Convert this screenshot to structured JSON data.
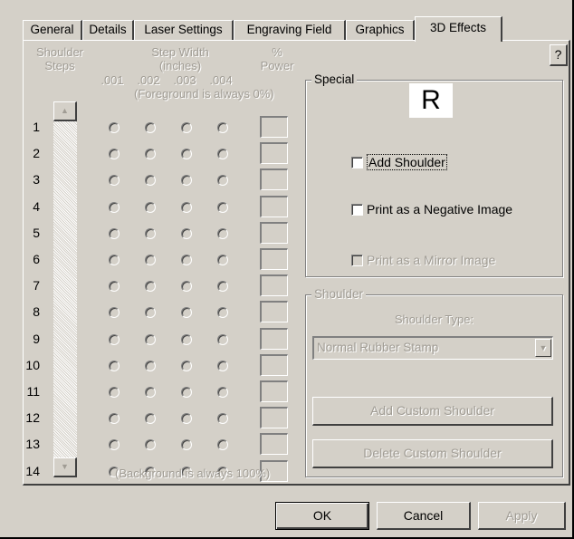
{
  "tabs": [
    "General",
    "Details",
    "Laser Settings",
    "Engraving Field",
    "Graphics",
    "3D Effects"
  ],
  "active_tab": "3D Effects",
  "help_label": "?",
  "shoulder_steps": {
    "header_line1": "Shoulder",
    "header_line2": "Steps",
    "rows": [
      "1",
      "2",
      "3",
      "4",
      "5",
      "6",
      "7",
      "8",
      "9",
      "10",
      "11",
      "12",
      "13",
      "14"
    ]
  },
  "step_width": {
    "header_line1": "Step Width",
    "header_line2": "(inches)",
    "columns": [
      ".001",
      ".002",
      ".003",
      ".004"
    ]
  },
  "power": {
    "header_line1": "%",
    "header_line2": "Power"
  },
  "foreground_note": "(Foreground is always 0%)",
  "background_note": "(Background is always 100%)",
  "special": {
    "legend": "Special",
    "preview_letter": "R",
    "add_shoulder": "Add Shoulder",
    "print_negative": "Print as a Negative Image",
    "print_mirror": "Print as a Mirror Image"
  },
  "shoulder_group": {
    "legend": "Shoulder",
    "type_label": "Shoulder Type:",
    "type_value": "Normal Rubber Stamp",
    "add_custom": "Add Custom Shoulder",
    "delete_custom": "Delete Custom Shoulder"
  },
  "footer": {
    "ok": "OK",
    "cancel": "Cancel",
    "apply": "Apply"
  }
}
